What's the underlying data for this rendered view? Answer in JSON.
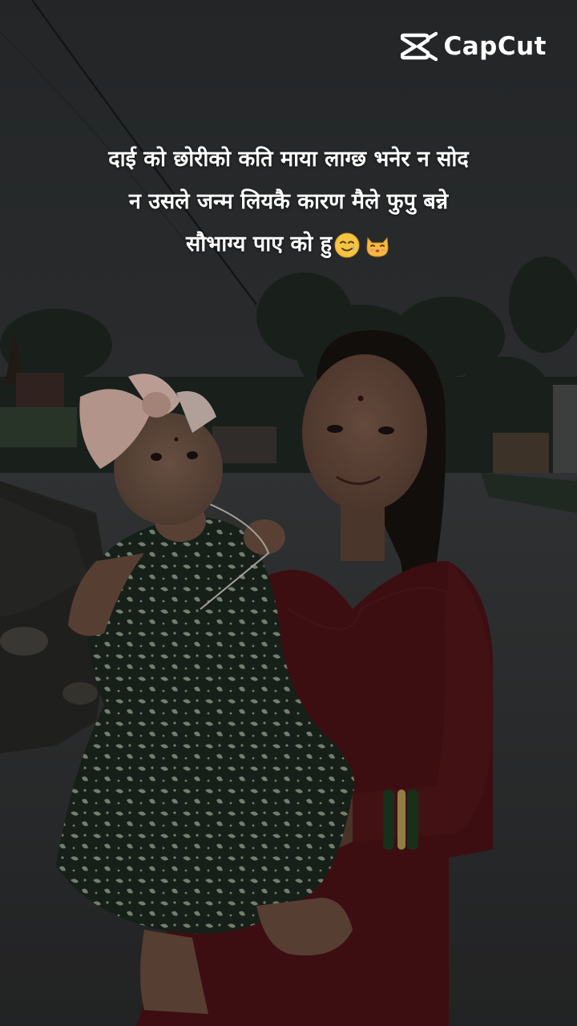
{
  "brand": {
    "name": "CapCut",
    "icon": "capcut-logo-icon"
  },
  "caption": {
    "lines": [
      "दाई को छोरीको कति माया लाग्छ भनेर न सोद",
      "न उसले जन्म लियकै कारण मैले फुपु बन्ने",
      "सौभाग्य पाए को हु"
    ],
    "emojis": [
      "smiling-face-with-tear-icon",
      "kissing-cat-icon"
    ]
  }
}
